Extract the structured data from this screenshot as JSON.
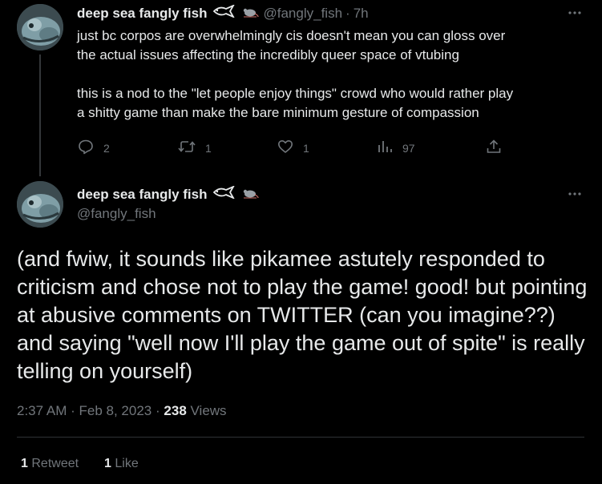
{
  "tweet1": {
    "display_name": "deep sea fangly fish",
    "handle": "@fangly_fish",
    "separator": "·",
    "time": "7h",
    "text": "just bc corpos are overwhelmingly cis doesn't mean you can gloss over\nthe actual issues affecting the incredibly queer space of vtubing\n\nthis is a nod to the \"let people enjoy things\" crowd who would rather play\na shitty game than make the bare minimum gesture of compassion",
    "actions": {
      "replies": "2",
      "retweets": "1",
      "likes": "1",
      "views": "97"
    },
    "name_icons": [
      "fish-outline-icon",
      "rat-icon"
    ]
  },
  "tweet2": {
    "display_name": "deep sea fangly fish",
    "handle": "@fangly_fish",
    "text": "(and fwiw, it sounds like pikamee astutely responded to criticism and chose not to play the game! good! but pointing at abusive comments on TWITTER (can you imagine??) and saying \"well now I'll play the game out of spite\" is really telling on yourself)",
    "time": "2:37 AM",
    "date": "Feb 8, 2023",
    "separator": "·",
    "views_count": "238",
    "views_label": "Views",
    "retweets_count": "1",
    "retweets_label": "Retweet",
    "likes_count": "1",
    "likes_label": "Like",
    "name_icons": [
      "fish-outline-icon",
      "rat-icon"
    ]
  },
  "colors": {
    "background": "#000000",
    "primary_text": "#e7e9ea",
    "secondary_text": "#71767b",
    "divider": "#2f3336",
    "thread_line": "#333639"
  }
}
